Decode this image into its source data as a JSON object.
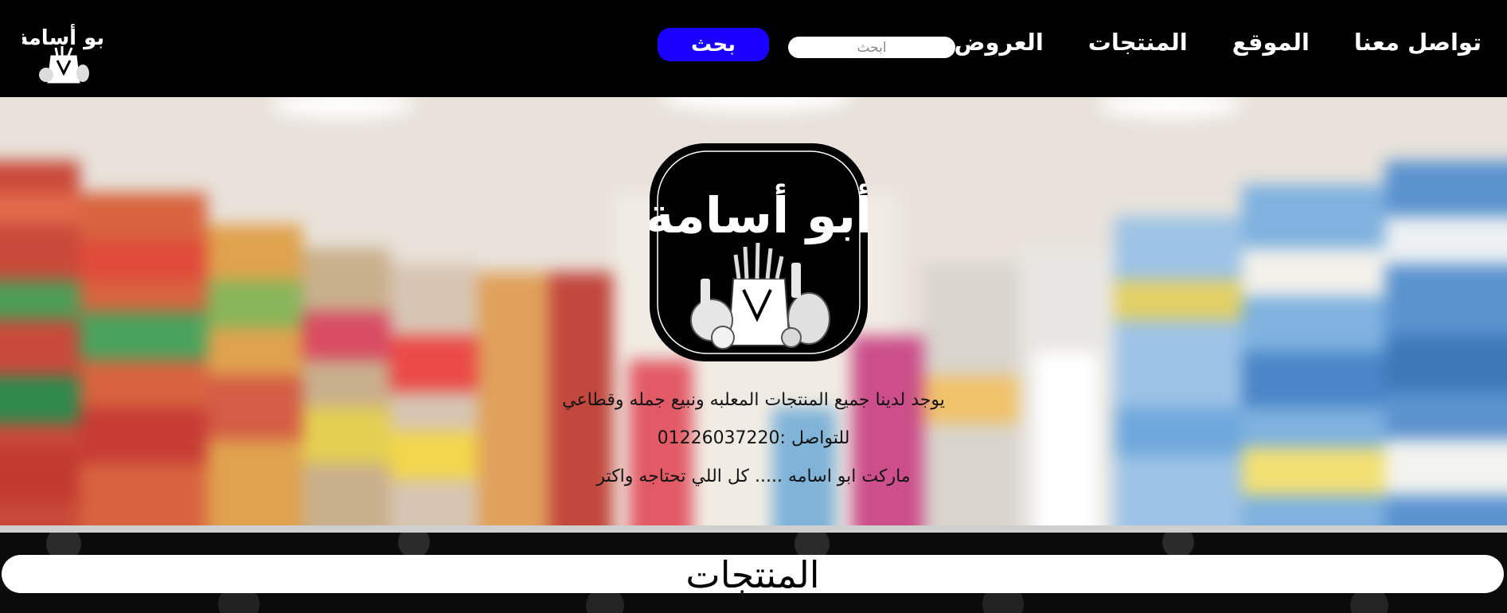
{
  "nav": {
    "links": [
      "تواصل معنا",
      "الموقع",
      "المنتجات",
      "العروض"
    ],
    "search_placeholder": "ابحث",
    "search_button": "بحث",
    "logo_text": "أبو أسامة"
  },
  "hero": {
    "logo_text": "أبو أسامة",
    "line1": "يوجد لدينا جميع المنتجات المعلبه ونبيع جمله وقطاعي",
    "line2": "للتواصل :01226037220",
    "line3": "ماركت ابو اسامه ..... كل اللي تحتاجه واكتر"
  },
  "products": {
    "title": "المنتجات"
  },
  "colors": {
    "nav_background": "#000000",
    "search_button": "#1a00ff",
    "logo_background": "#000000"
  },
  "icons": [
    "grocery-bag-icon"
  ]
}
